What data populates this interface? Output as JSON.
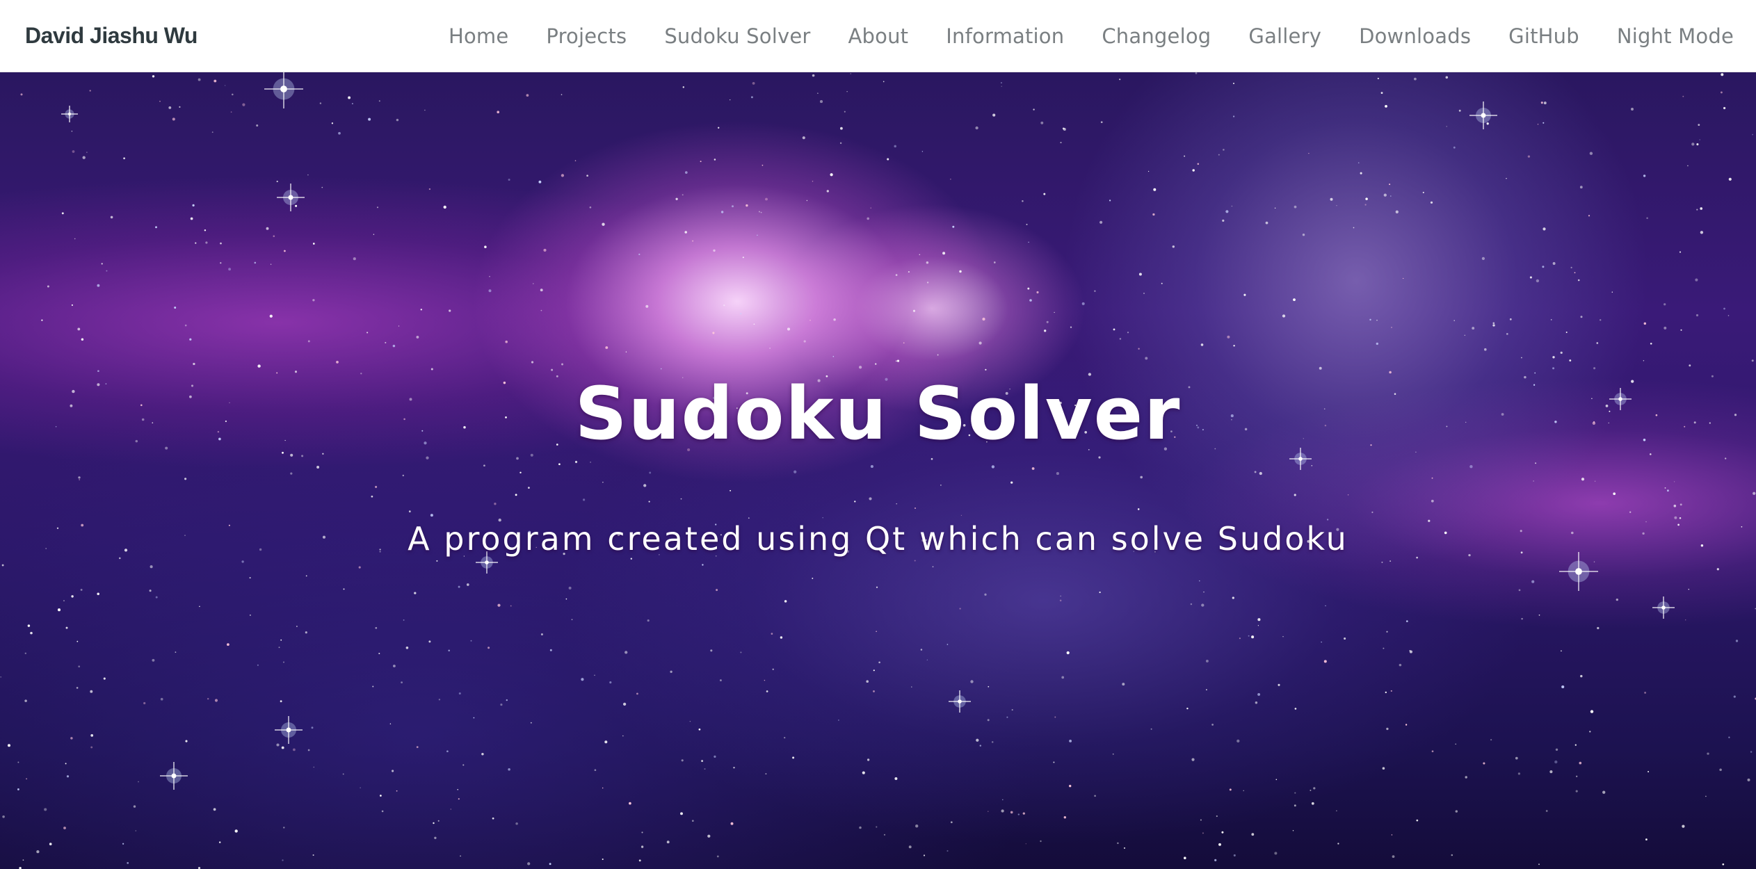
{
  "navbar": {
    "brand": "David Jiashu Wu",
    "links": [
      {
        "label": "Home"
      },
      {
        "label": "Projects"
      },
      {
        "label": "Sudoku Solver"
      },
      {
        "label": "About"
      },
      {
        "label": "Information"
      },
      {
        "label": "Changelog"
      },
      {
        "label": "Gallery"
      },
      {
        "label": "Downloads"
      },
      {
        "label": "GitHub"
      },
      {
        "label": "Night Mode"
      }
    ]
  },
  "hero": {
    "title": "Sudoku Solver",
    "subtitle": "A program created using Qt which can solve Sudoku",
    "background": "galaxy-nebula-image"
  },
  "colors": {
    "navbar_bg": "#ffffff",
    "brand_text": "#2f3a3f",
    "nav_link_text": "#7a7f82",
    "hero_text": "#ffffff",
    "hero_bg_dark": "#1c1250",
    "hero_bg_purple": "#b050c8"
  }
}
